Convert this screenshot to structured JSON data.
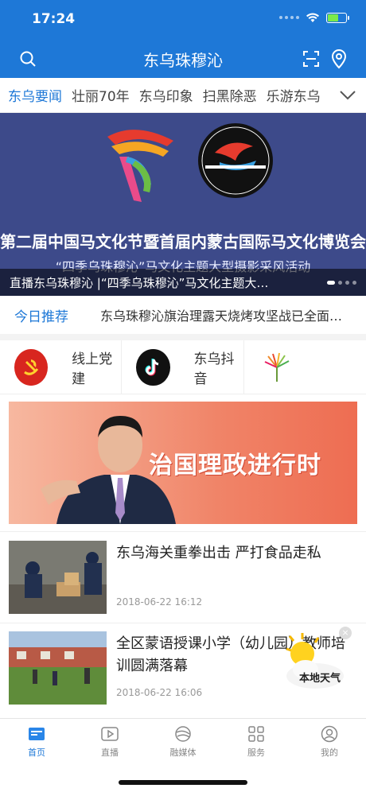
{
  "status": {
    "time": "17:24"
  },
  "nav": {
    "title": "东乌珠穆沁"
  },
  "tabs": [
    "东乌要闻",
    "壮丽70年",
    "东乌印象",
    "扫黑除恶",
    "乐游东乌"
  ],
  "banner": {
    "title": "第二届中国马文化节暨首届内蒙古国际马文化博览会",
    "subtitle": "“四季乌珠穆沁”马文化主题大型摄影采风活动",
    "caption": "直播东乌珠穆沁 |“四季乌珠穆沁”马文化主题大型摄影采风活动"
  },
  "today": {
    "label": "今日推荐",
    "text": "东乌珠穆沁旗治理露天烧烤攻坚战已全面展开"
  },
  "shortcuts": [
    {
      "label": "线上党建",
      "icon": "party-emblem-icon"
    },
    {
      "label": "东乌抖音",
      "icon": "tiktok-icon"
    }
  ],
  "promo": {
    "text": "治国理政进行时"
  },
  "news": [
    {
      "title": "东乌海关重拳出击  严打食品走私",
      "date": "2018-06-22 16:12"
    },
    {
      "title": "全区蒙语授课小学（幼儿园）教师培训圆满落幕",
      "date": "2018-06-22 16:06"
    }
  ],
  "weather": {
    "label": "本地天气"
  },
  "tabbar": [
    {
      "label": "首页",
      "icon": "home-icon"
    },
    {
      "label": "直播",
      "icon": "play-icon"
    },
    {
      "label": "融媒体",
      "icon": "media-icon"
    },
    {
      "label": "服务",
      "icon": "grid-icon"
    },
    {
      "label": "我的",
      "icon": "user-icon"
    }
  ],
  "colors": {
    "brand": "#1e78d7",
    "promo": "#ee6d52",
    "banner": "#3d4a8a"
  }
}
